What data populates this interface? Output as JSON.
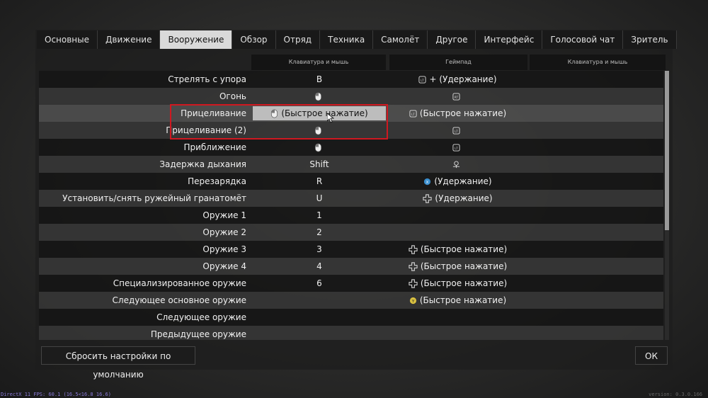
{
  "tabs": [
    {
      "label": "Основные",
      "active": false
    },
    {
      "label": "Движение",
      "active": false
    },
    {
      "label": "Вооружение",
      "active": true
    },
    {
      "label": "Обзор",
      "active": false
    },
    {
      "label": "Отряд",
      "active": false
    },
    {
      "label": "Техника",
      "active": false
    },
    {
      "label": "Самолёт",
      "active": false
    },
    {
      "label": "Другое",
      "active": false
    },
    {
      "label": "Интерфейс",
      "active": false
    },
    {
      "label": "Голосовой чат",
      "active": false
    },
    {
      "label": "Зритель",
      "active": false
    }
  ],
  "columns": {
    "col1": "Клавиатура и мышь",
    "col2": "Геймпад",
    "col3": "Клавиатура и мышь"
  },
  "rows": [
    {
      "name": "Стрелять с упора",
      "kbm": "B",
      "kbm_icon": "",
      "pad": "+ (Удержание)",
      "pad_icon": "lt-plus-dpad-icon"
    },
    {
      "name": "Огонь",
      "kbm": "",
      "kbm_icon": "mouse-icon",
      "pad": "",
      "pad_icon": "rt-trigger-icon"
    },
    {
      "name": "Прицеливание",
      "kbm": "(Быстрое нажатие)",
      "kbm_icon": "mouse-icon",
      "pad": "(Быстрое нажатие)",
      "pad_icon": "lt-trigger-icon",
      "highlight": true,
      "selected": true
    },
    {
      "name": "Прицеливание (2)",
      "kbm": "",
      "kbm_icon": "mouse-icon",
      "pad": "",
      "pad_icon": "lt-trigger-icon"
    },
    {
      "name": "Приближение",
      "kbm": "",
      "kbm_icon": "mouse-icon",
      "pad": "",
      "pad_icon": "lt-trigger-icon"
    },
    {
      "name": "Задержка дыхания",
      "kbm": "Shift",
      "kbm_icon": "",
      "pad": "",
      "pad_icon": "left-stick-icon"
    },
    {
      "name": "Перезарядка",
      "kbm": "R",
      "kbm_icon": "",
      "pad": "(Удержание)",
      "pad_icon": "x-button-icon"
    },
    {
      "name": "Установить/снять ружейный гранатомёт",
      "kbm": "U",
      "kbm_icon": "",
      "pad": "(Удержание)",
      "pad_icon": "dpad-icon"
    },
    {
      "name": "Оружие 1",
      "kbm": "1",
      "kbm_icon": "",
      "pad": "",
      "pad_icon": ""
    },
    {
      "name": "Оружие 2",
      "kbm": "2",
      "kbm_icon": "",
      "pad": "",
      "pad_icon": ""
    },
    {
      "name": "Оружие 3",
      "kbm": "3",
      "kbm_icon": "",
      "pad": "(Быстрое нажатие)",
      "pad_icon": "dpad-icon"
    },
    {
      "name": "Оружие 4",
      "kbm": "4",
      "kbm_icon": "",
      "pad": "(Быстрое нажатие)",
      "pad_icon": "dpad-icon"
    },
    {
      "name": "Специализированное оружие",
      "kbm": "6",
      "kbm_icon": "",
      "pad": "(Быстрое нажатие)",
      "pad_icon": "dpad-icon"
    },
    {
      "name": "Следующее основное оружие",
      "kbm": "",
      "kbm_icon": "",
      "pad": "(Быстрое нажатие)",
      "pad_icon": "y-button-icon"
    },
    {
      "name": "Следующее оружие",
      "kbm": "",
      "kbm_icon": "",
      "pad": "",
      "pad_icon": ""
    },
    {
      "name": "Предыдущее оружие",
      "kbm": "",
      "kbm_icon": "",
      "pad": "",
      "pad_icon": ""
    }
  ],
  "buttons": {
    "reset": "Сбросить настройки по умолчанию",
    "ok": "ОК"
  },
  "footer": {
    "left": "DirectX 11 FPS: 60.1 (16.5<16.8 16.6)",
    "right": "version: 0.3.0.166"
  },
  "colors": {
    "accent_red": "#d01820",
    "active_tab": "#d9d9d9",
    "x_button": "#3a8fd0",
    "y_button": "#d8c040"
  }
}
